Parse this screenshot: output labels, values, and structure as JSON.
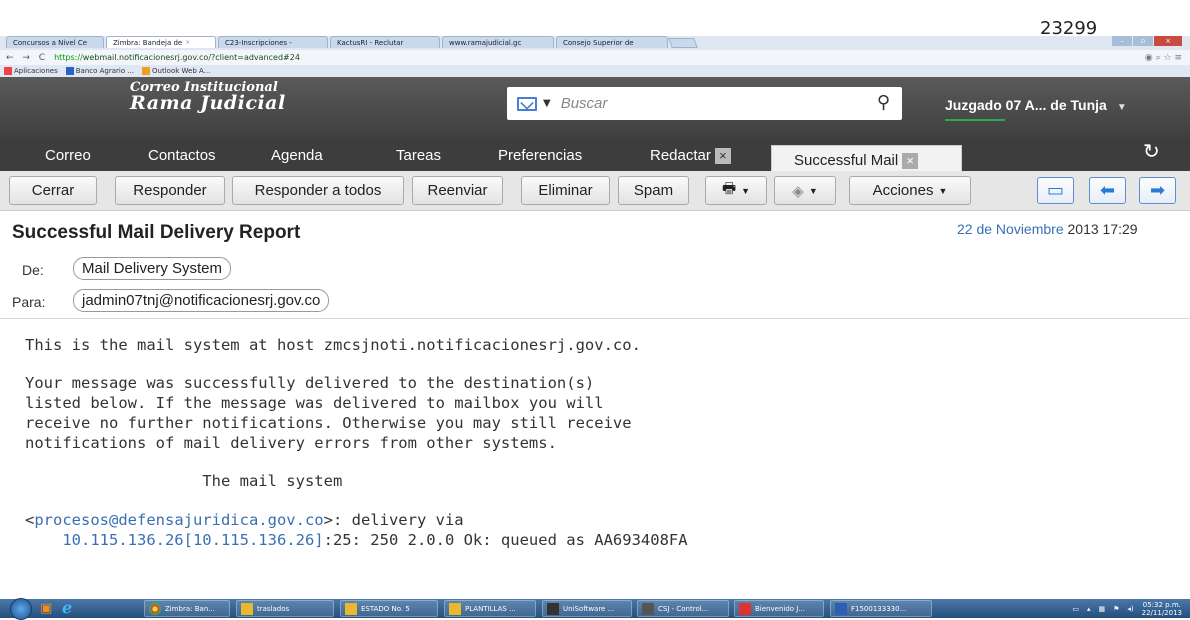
{
  "doc_number": "23299",
  "browser": {
    "tabs": [
      {
        "label": "Concursos a Nivel Ce"
      },
      {
        "label": "Zimbra: Bandeja de"
      },
      {
        "label": "C23-Inscripciones -"
      },
      {
        "label": "KactusRI - Reclutar"
      },
      {
        "label": "www.ramajudicial.gc"
      },
      {
        "label": "Consejo Superior de"
      }
    ],
    "url_scheme": "https://",
    "url_rest": "webmail.notificacionesrj.gov.co/?client=advanced#24",
    "bookmarks": [
      {
        "label": "Aplicaciones"
      },
      {
        "label": "Banco Agrario ..."
      },
      {
        "label": "Outlook Web A..."
      }
    ]
  },
  "app": {
    "brand_top": "Correo Institucional",
    "brand_main": "Rama Judicial",
    "search_placeholder": "Buscar",
    "user_label": "Juzgado 07 A... de Tunja"
  },
  "nav": {
    "tabs": [
      {
        "label": "Correo"
      },
      {
        "label": "Contactos"
      },
      {
        "label": "Agenda"
      },
      {
        "label": "Tareas"
      },
      {
        "label": "Preferencias"
      },
      {
        "label": "Redactar"
      }
    ],
    "active_tab": "Successful Mail"
  },
  "toolbar": {
    "close": "Cerrar",
    "reply": "Responder",
    "reply_all": "Responder a todos",
    "forward": "Reenviar",
    "delete": "Eliminar",
    "spam": "Spam",
    "actions": "Acciones"
  },
  "message": {
    "subject": "Successful Mail Delivery Report",
    "date_part": "22 de Noviembre",
    "date_rest": "2013 17:29",
    "from_label": "De:",
    "from": "Mail Delivery System",
    "to_label": "Para:",
    "to": "jadmin07tnj@notificacionesrj.gov.co",
    "body": [
      "This is the mail system at host zmcsjnoti.notificacionesrj.gov.co.",
      "Your message was successfully delivered to the destination(s)",
      "listed below. If the message was delivered to mailbox you will",
      "receive no further notifications. Otherwise you may still receive",
      "notifications of mail delivery errors from other systems.",
      "                   The mail system"
    ],
    "recipient_email": "procesos@defensajuridica.gov.co",
    "recipient_suffix": ">: delivery via",
    "relay_ip": "10.115.136.26[10.115.136.26]",
    "relay_status": ":25: 250 2.0.0 Ok: queued as AA693408FA"
  },
  "taskbar": {
    "items": [
      {
        "label": "Zimbra: Ban..."
      },
      {
        "label": "traslados"
      },
      {
        "label": "ESTADO No. 5"
      },
      {
        "label": "PLANTILLAS ..."
      },
      {
        "label": "UniSoftware ..."
      },
      {
        "label": "CSJ - Control..."
      },
      {
        "label": "Bienvenido J..."
      },
      {
        "label": "F1500133330..."
      }
    ],
    "time": "05:32 p.m.",
    "date": "22/11/2013"
  }
}
